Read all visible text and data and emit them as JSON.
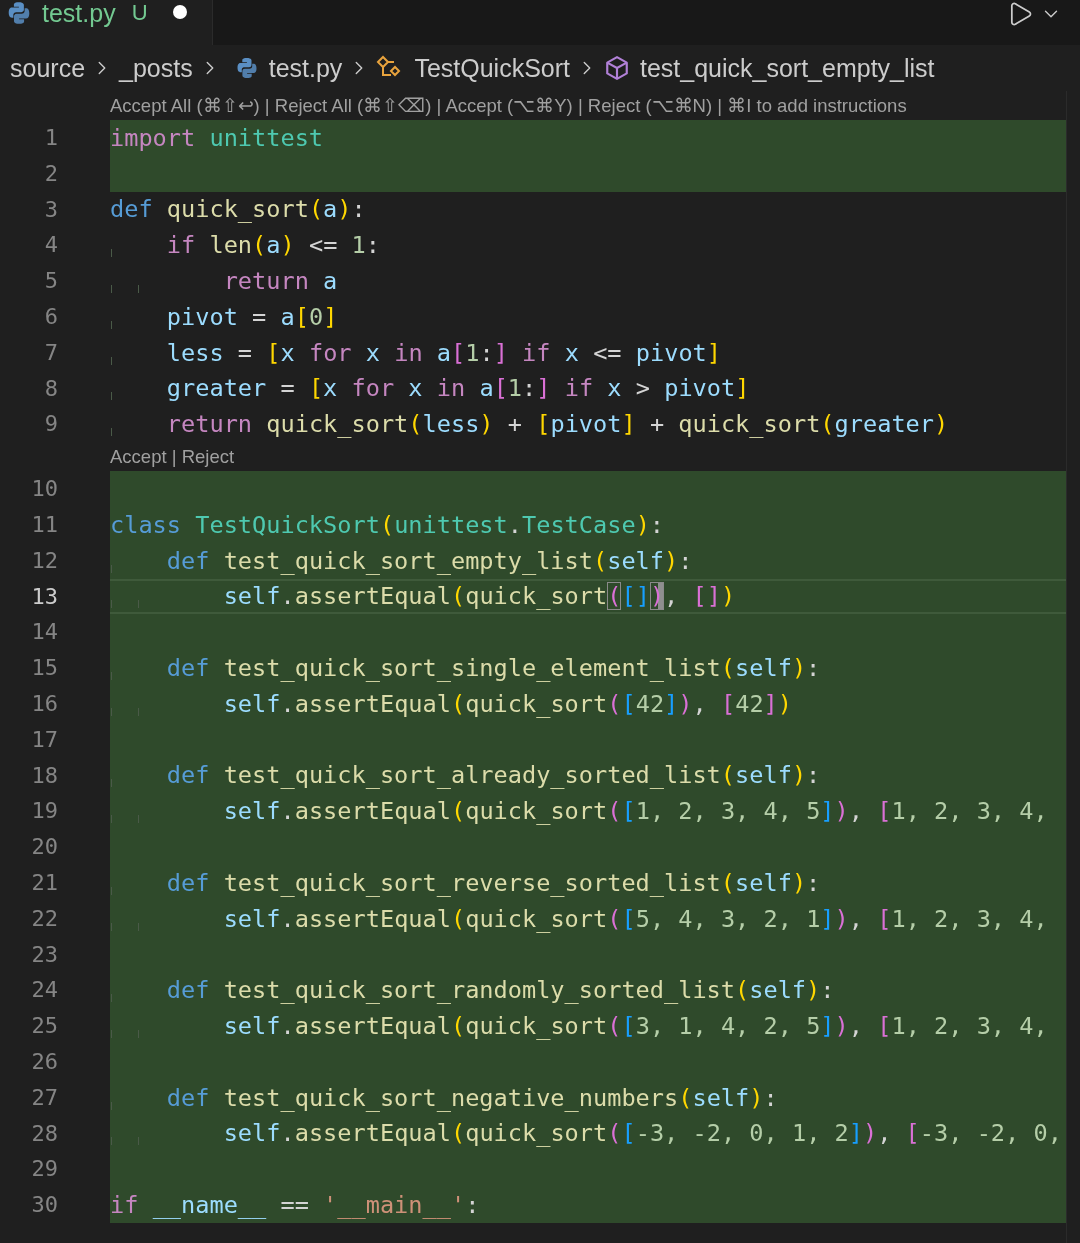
{
  "tab": {
    "label": "test.py",
    "status": "U",
    "modified": true,
    "selected": true
  },
  "breadcrumb": [
    {
      "label": "source",
      "kind": "folder"
    },
    {
      "label": "_posts",
      "kind": "folder"
    },
    {
      "label": "test.py",
      "kind": "file"
    },
    {
      "label": "TestQuickSort",
      "kind": "class"
    },
    {
      "label": "test_quick_sort_empty_list",
      "kind": "method"
    }
  ],
  "editor": {
    "lines": [
      {
        "kind": "lens",
        "text": "Accept All (⌘⇧↩) | Reject All (⌘⇧⌫) | Accept (⌥⌘Y) | Reject (⌥⌘N) | ⌘I to add instructions"
      },
      {
        "kind": "code",
        "number": "1",
        "added": true,
        "current": false,
        "tokens": [
          {
            "text": "import ",
            "kind": "kw"
          },
          {
            "text": "unittest",
            "kind": "cls"
          }
        ]
      },
      {
        "kind": "code",
        "number": "2",
        "added": true,
        "current": false
      },
      {
        "kind": "code",
        "number": "3",
        "added": false,
        "current": false,
        "tokens": [
          {
            "text": "def ",
            "kind": "def"
          },
          {
            "text": "quick_sort",
            "kind": "fn"
          },
          {
            "text": "(",
            "kind": "b1"
          },
          {
            "text": "a",
            "kind": "var"
          },
          {
            "text": ")",
            "kind": "b1"
          },
          {
            "text": ":",
            "kind": "p"
          }
        ]
      },
      {
        "kind": "code",
        "number": "4",
        "added": false,
        "current": false,
        "tokens": [
          {
            "text": "    if ",
            "kind": "kw"
          },
          {
            "text": "len",
            "kind": "fn"
          },
          {
            "text": "(",
            "kind": "b1"
          },
          {
            "text": "a",
            "kind": "var"
          },
          {
            "text": ")",
            "kind": "b1"
          },
          {
            "text": " <= ",
            "kind": "p"
          },
          {
            "text": "1",
            "kind": "num"
          },
          {
            "text": ":",
            "kind": "p"
          }
        ]
      },
      {
        "kind": "code",
        "number": "5",
        "added": false,
        "current": false,
        "tokens": [
          {
            "text": "        return ",
            "kind": "kw"
          },
          {
            "text": "a",
            "kind": "var"
          }
        ]
      },
      {
        "kind": "code",
        "number": "6",
        "added": false,
        "current": false,
        "tokens": [
          {
            "text": "    pivot",
            "kind": "var"
          },
          {
            "text": " = ",
            "kind": "p"
          },
          {
            "text": "a",
            "kind": "var"
          },
          {
            "text": "[",
            "kind": "b1"
          },
          {
            "text": "0",
            "kind": "num"
          },
          {
            "text": "]",
            "kind": "b1"
          }
        ]
      },
      {
        "kind": "code",
        "number": "7",
        "added": false,
        "current": false,
        "tokens": [
          {
            "text": "    less",
            "kind": "var"
          },
          {
            "text": " = ",
            "kind": "p"
          },
          {
            "text": "[",
            "kind": "b1"
          },
          {
            "text": "x ",
            "kind": "var"
          },
          {
            "text": "for ",
            "kind": "kw"
          },
          {
            "text": "x ",
            "kind": "var"
          },
          {
            "text": "in ",
            "kind": "kw"
          },
          {
            "text": "a",
            "kind": "var"
          },
          {
            "text": "[",
            "kind": "b2"
          },
          {
            "text": "1",
            "kind": "num"
          },
          {
            "text": ":",
            "kind": "p"
          },
          {
            "text": "] ",
            "kind": "b2"
          },
          {
            "text": "if ",
            "kind": "kw"
          },
          {
            "text": "x",
            "kind": "var"
          },
          {
            "text": " <= ",
            "kind": "p"
          },
          {
            "text": "pivot",
            "kind": "var"
          },
          {
            "text": "]",
            "kind": "b1"
          }
        ]
      },
      {
        "kind": "code",
        "number": "8",
        "added": false,
        "current": false,
        "tokens": [
          {
            "text": "    greater",
            "kind": "var"
          },
          {
            "text": " = ",
            "kind": "p"
          },
          {
            "text": "[",
            "kind": "b1"
          },
          {
            "text": "x ",
            "kind": "var"
          },
          {
            "text": "for ",
            "kind": "kw"
          },
          {
            "text": "x ",
            "kind": "var"
          },
          {
            "text": "in ",
            "kind": "kw"
          },
          {
            "text": "a",
            "kind": "var"
          },
          {
            "text": "[",
            "kind": "b2"
          },
          {
            "text": "1",
            "kind": "num"
          },
          {
            "text": ":",
            "kind": "p"
          },
          {
            "text": "] ",
            "kind": "b2"
          },
          {
            "text": "if ",
            "kind": "kw"
          },
          {
            "text": "x",
            "kind": "var"
          },
          {
            "text": " > ",
            "kind": "p"
          },
          {
            "text": "pivot",
            "kind": "var"
          },
          {
            "text": "]",
            "kind": "b1"
          }
        ]
      },
      {
        "kind": "code",
        "number": "9",
        "added": false,
        "current": false,
        "tokens": [
          {
            "text": "    return ",
            "kind": "kw"
          },
          {
            "text": "quick_sort",
            "kind": "fn"
          },
          {
            "text": "(",
            "kind": "b1"
          },
          {
            "text": "less",
            "kind": "var"
          },
          {
            "text": ")",
            "kind": "b1"
          },
          {
            "text": " + ",
            "kind": "p"
          },
          {
            "text": "[",
            "kind": "b1"
          },
          {
            "text": "pivot",
            "kind": "var"
          },
          {
            "text": "]",
            "kind": "b1"
          },
          {
            "text": " + ",
            "kind": "p"
          },
          {
            "text": "quick_sort",
            "kind": "fn"
          },
          {
            "text": "(",
            "kind": "b1"
          },
          {
            "text": "greater",
            "kind": "var"
          },
          {
            "text": ")",
            "kind": "b1"
          }
        ]
      },
      {
        "kind": "lens",
        "text": "Accept | Reject"
      },
      {
        "kind": "code",
        "number": "10",
        "added": true,
        "current": false
      },
      {
        "kind": "code",
        "number": "11",
        "added": true,
        "current": false,
        "tokens": [
          {
            "text": "class ",
            "kind": "def"
          },
          {
            "text": "TestQuickSort",
            "kind": "cls"
          },
          {
            "text": "(",
            "kind": "b1"
          },
          {
            "text": "unittest",
            "kind": "cls"
          },
          {
            "text": ".",
            "kind": "p"
          },
          {
            "text": "TestCase",
            "kind": "cls"
          },
          {
            "text": ")",
            "kind": "b1"
          },
          {
            "text": ":",
            "kind": "p"
          }
        ]
      },
      {
        "kind": "code",
        "number": "12",
        "added": true,
        "current": false,
        "tokens": [
          {
            "text": "    def ",
            "kind": "def"
          },
          {
            "text": "test_quick_sort_empty_list",
            "kind": "fn"
          },
          {
            "text": "(",
            "kind": "b1"
          },
          {
            "text": "self",
            "kind": "var"
          },
          {
            "text": ")",
            "kind": "b1"
          },
          {
            "text": ":",
            "kind": "p"
          }
        ]
      },
      {
        "kind": "code",
        "number": "13",
        "added": true,
        "current": true,
        "tokens": [
          {
            "text": "        self",
            "kind": "var"
          },
          {
            "text": ".",
            "kind": "p"
          },
          {
            "text": "assertEqual",
            "kind": "fn"
          },
          {
            "text": "(",
            "kind": "b1"
          },
          {
            "text": "quick_sort",
            "kind": "fn"
          },
          {
            "text": "(",
            "kind": "b2m"
          },
          {
            "text": "[]",
            "kind": "b3"
          },
          {
            "text": ")",
            "kind": "b2c"
          },
          {
            "text": ", ",
            "kind": "p"
          },
          {
            "text": "[]",
            "kind": "b2"
          },
          {
            "text": ")",
            "kind": "b1"
          }
        ]
      },
      {
        "kind": "code",
        "number": "14",
        "added": true,
        "current": false
      },
      {
        "kind": "code",
        "number": "15",
        "added": true,
        "current": false,
        "tokens": [
          {
            "text": "    def ",
            "kind": "def"
          },
          {
            "text": "test_quick_sort_single_element_list",
            "kind": "fn"
          },
          {
            "text": "(",
            "kind": "b1"
          },
          {
            "text": "self",
            "kind": "var"
          },
          {
            "text": ")",
            "kind": "b1"
          },
          {
            "text": ":",
            "kind": "p"
          }
        ]
      },
      {
        "kind": "code",
        "number": "16",
        "added": true,
        "current": false,
        "tokens": [
          {
            "text": "        self",
            "kind": "var"
          },
          {
            "text": ".",
            "kind": "p"
          },
          {
            "text": "assertEqual",
            "kind": "fn"
          },
          {
            "text": "(",
            "kind": "b1"
          },
          {
            "text": "quick_sort",
            "kind": "fn"
          },
          {
            "text": "(",
            "kind": "b2"
          },
          {
            "text": "[",
            "kind": "b3"
          },
          {
            "text": "42",
            "kind": "num"
          },
          {
            "text": "]",
            "kind": "b3"
          },
          {
            "text": ")",
            "kind": "b2"
          },
          {
            "text": ", ",
            "kind": "p"
          },
          {
            "text": "[",
            "kind": "b2"
          },
          {
            "text": "42",
            "kind": "num"
          },
          {
            "text": "]",
            "kind": "b2"
          },
          {
            "text": ")",
            "kind": "b1"
          }
        ]
      },
      {
        "kind": "code",
        "number": "17",
        "added": true,
        "current": false
      },
      {
        "kind": "code",
        "number": "18",
        "added": true,
        "current": false,
        "tokens": [
          {
            "text": "    def ",
            "kind": "def"
          },
          {
            "text": "test_quick_sort_already_sorted_list",
            "kind": "fn"
          },
          {
            "text": "(",
            "kind": "b1"
          },
          {
            "text": "self",
            "kind": "var"
          },
          {
            "text": ")",
            "kind": "b1"
          },
          {
            "text": ":",
            "kind": "p"
          }
        ]
      },
      {
        "kind": "code",
        "number": "19",
        "added": true,
        "current": false,
        "tokens": [
          {
            "text": "        self",
            "kind": "var"
          },
          {
            "text": ".",
            "kind": "p"
          },
          {
            "text": "assertEqual",
            "kind": "fn"
          },
          {
            "text": "(",
            "kind": "b1"
          },
          {
            "text": "quick_sort",
            "kind": "fn"
          },
          {
            "text": "(",
            "kind": "b2"
          },
          {
            "text": "[",
            "kind": "b3"
          },
          {
            "text": "1, 2, 3, 4, 5",
            "kind": "num"
          },
          {
            "text": "]",
            "kind": "b3"
          },
          {
            "text": ")",
            "kind": "b2"
          },
          {
            "text": ", ",
            "kind": "p"
          },
          {
            "text": "[",
            "kind": "b2"
          },
          {
            "text": "1, 2, 3, 4,",
            "kind": "num"
          }
        ]
      },
      {
        "kind": "code",
        "number": "20",
        "added": true,
        "current": false
      },
      {
        "kind": "code",
        "number": "21",
        "added": true,
        "current": false,
        "tokens": [
          {
            "text": "    def ",
            "kind": "def"
          },
          {
            "text": "test_quick_sort_reverse_sorted_list",
            "kind": "fn"
          },
          {
            "text": "(",
            "kind": "b1"
          },
          {
            "text": "self",
            "kind": "var"
          },
          {
            "text": ")",
            "kind": "b1"
          },
          {
            "text": ":",
            "kind": "p"
          }
        ]
      },
      {
        "kind": "code",
        "number": "22",
        "added": true,
        "current": false,
        "tokens": [
          {
            "text": "        self",
            "kind": "var"
          },
          {
            "text": ".",
            "kind": "p"
          },
          {
            "text": "assertEqual",
            "kind": "fn"
          },
          {
            "text": "(",
            "kind": "b1"
          },
          {
            "text": "quick_sort",
            "kind": "fn"
          },
          {
            "text": "(",
            "kind": "b2"
          },
          {
            "text": "[",
            "kind": "b3"
          },
          {
            "text": "5, 4, 3, 2, 1",
            "kind": "num"
          },
          {
            "text": "]",
            "kind": "b3"
          },
          {
            "text": ")",
            "kind": "b2"
          },
          {
            "text": ", ",
            "kind": "p"
          },
          {
            "text": "[",
            "kind": "b2"
          },
          {
            "text": "1, 2, 3, 4,",
            "kind": "num"
          }
        ]
      },
      {
        "kind": "code",
        "number": "23",
        "added": true,
        "current": false
      },
      {
        "kind": "code",
        "number": "24",
        "added": true,
        "current": false,
        "tokens": [
          {
            "text": "    def ",
            "kind": "def"
          },
          {
            "text": "test_quick_sort_randomly_sorted_list",
            "kind": "fn"
          },
          {
            "text": "(",
            "kind": "b1"
          },
          {
            "text": "self",
            "kind": "var"
          },
          {
            "text": ")",
            "kind": "b1"
          },
          {
            "text": ":",
            "kind": "p"
          }
        ]
      },
      {
        "kind": "code",
        "number": "25",
        "added": true,
        "current": false,
        "tokens": [
          {
            "text": "        self",
            "kind": "var"
          },
          {
            "text": ".",
            "kind": "p"
          },
          {
            "text": "assertEqual",
            "kind": "fn"
          },
          {
            "text": "(",
            "kind": "b1"
          },
          {
            "text": "quick_sort",
            "kind": "fn"
          },
          {
            "text": "(",
            "kind": "b2"
          },
          {
            "text": "[",
            "kind": "b3"
          },
          {
            "text": "3, 1, 4, 2, 5",
            "kind": "num"
          },
          {
            "text": "]",
            "kind": "b3"
          },
          {
            "text": ")",
            "kind": "b2"
          },
          {
            "text": ", ",
            "kind": "p"
          },
          {
            "text": "[",
            "kind": "b2"
          },
          {
            "text": "1, 2, 3, 4,",
            "kind": "num"
          }
        ]
      },
      {
        "kind": "code",
        "number": "26",
        "added": true,
        "current": false
      },
      {
        "kind": "code",
        "number": "27",
        "added": true,
        "current": false,
        "tokens": [
          {
            "text": "    def ",
            "kind": "def"
          },
          {
            "text": "test_quick_sort_negative_numbers",
            "kind": "fn"
          },
          {
            "text": "(",
            "kind": "b1"
          },
          {
            "text": "self",
            "kind": "var"
          },
          {
            "text": ")",
            "kind": "b1"
          },
          {
            "text": ":",
            "kind": "p"
          }
        ]
      },
      {
        "kind": "code",
        "number": "28",
        "added": true,
        "current": false,
        "tokens": [
          {
            "text": "        self",
            "kind": "var"
          },
          {
            "text": ".",
            "kind": "p"
          },
          {
            "text": "assertEqual",
            "kind": "fn"
          },
          {
            "text": "(",
            "kind": "b1"
          },
          {
            "text": "quick_sort",
            "kind": "fn"
          },
          {
            "text": "(",
            "kind": "b2"
          },
          {
            "text": "[",
            "kind": "b3"
          },
          {
            "text": "-3, -2, 0, 1, 2",
            "kind": "num"
          },
          {
            "text": "]",
            "kind": "b3"
          },
          {
            "text": ")",
            "kind": "b2"
          },
          {
            "text": ", ",
            "kind": "p"
          },
          {
            "text": "[",
            "kind": "b2"
          },
          {
            "text": "-3, -2, 0,",
            "kind": "num"
          }
        ]
      },
      {
        "kind": "code",
        "number": "29",
        "added": true,
        "current": false
      },
      {
        "kind": "code",
        "number": "30",
        "added": true,
        "current": false,
        "tokens": [
          {
            "text": "if ",
            "kind": "kw"
          },
          {
            "text": "__name__",
            "kind": "var"
          },
          {
            "text": " == ",
            "kind": "p"
          },
          {
            "text": "'__main__'",
            "kind": "str"
          },
          {
            "text": ":",
            "kind": "p"
          }
        ]
      }
    ]
  }
}
